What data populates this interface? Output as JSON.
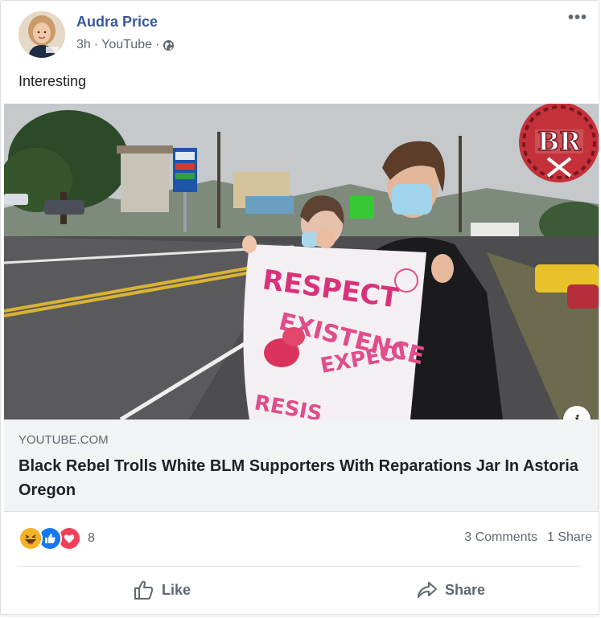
{
  "post": {
    "author": "Audra Price",
    "time": "3h",
    "source": "YouTube",
    "separator": "·",
    "text": "Interesting",
    "more_label": "•••"
  },
  "media": {
    "alt": "Video thumbnail showing two people holding a hand-painted banner on a roadside",
    "banner_text": [
      "RESPECT",
      "EXISTENCE",
      "EXPECT",
      "RESIS"
    ],
    "watermark_text": "BR"
  },
  "link": {
    "domain": "YOUTUBE.COM",
    "title": "Black Rebel Trolls White BLM Supporters With Reparations Jar In Astoria Oregon",
    "info_icon": "i"
  },
  "reactions": {
    "icons": [
      "haha-icon",
      "like-icon",
      "love-icon"
    ],
    "count": "8",
    "comments": "3 Comments",
    "shares": "1 Share"
  },
  "actions": {
    "like_label": "Like",
    "share_label": "Share"
  },
  "colors": {
    "author_link": "#385898",
    "secondary_text": "#606770",
    "like_blue": "#1877f2",
    "love_red": "#f33e58",
    "haha_yellow": "#f7b125"
  }
}
